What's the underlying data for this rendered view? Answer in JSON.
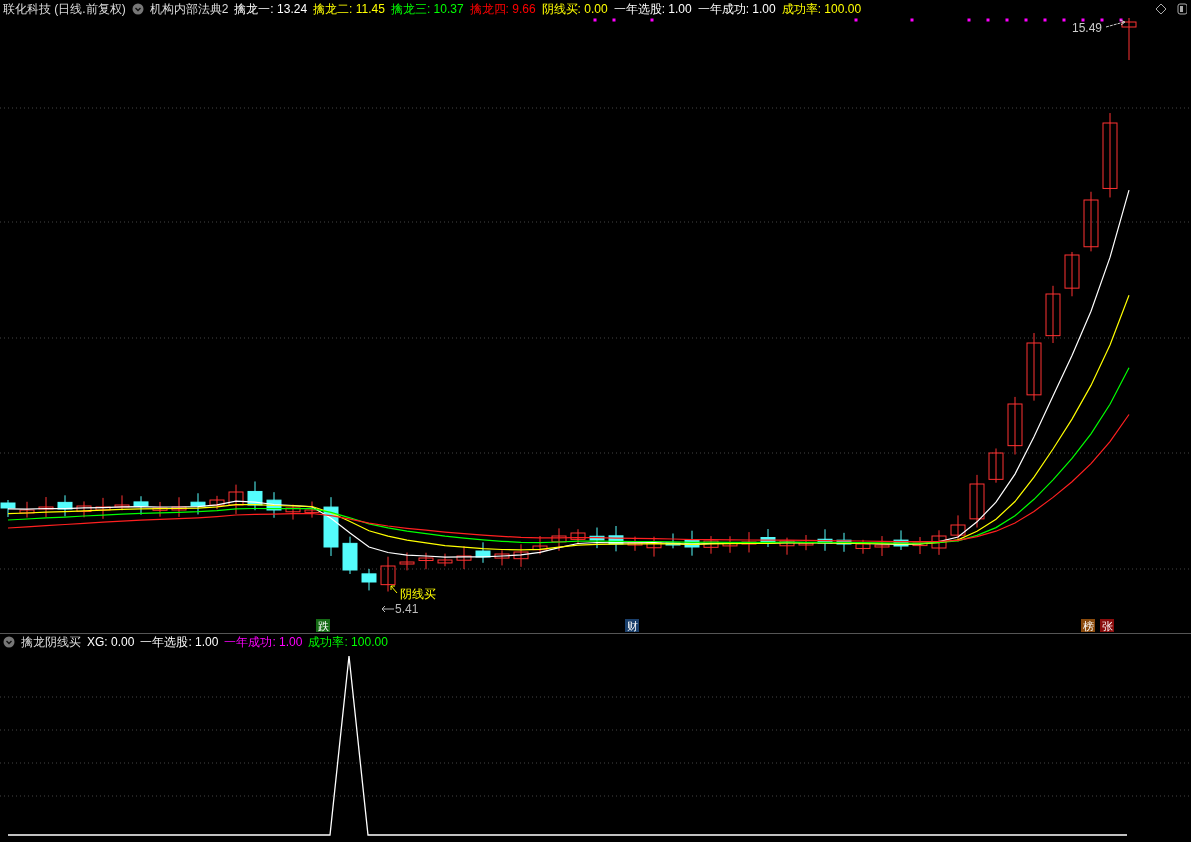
{
  "header": {
    "stock": "联化科技 (日线.前复权)",
    "indicator": "机构内部法典2",
    "values": [
      {
        "label": "擒龙一:",
        "value": "13.24",
        "color": "#ffffff"
      },
      {
        "label": "擒龙二:",
        "value": "11.45",
        "color": "#ffff00"
      },
      {
        "label": "擒龙三:",
        "value": "10.37",
        "color": "#00ff00"
      },
      {
        "label": "擒龙四:",
        "value": "9.66",
        "color": "#ff0000"
      },
      {
        "label": "阴线买:",
        "value": "0.00",
        "color": "#ffff00"
      },
      {
        "label": "一年选股:",
        "value": "1.00",
        "color": "#ffffff"
      },
      {
        "label": "一年成功:",
        "value": "1.00",
        "color": "#ffffff"
      },
      {
        "label": "成功率:",
        "value": "100.00",
        "color": "#ffff00"
      }
    ]
  },
  "main_chart": {
    "high_label": "15.49",
    "low_label": "5.41",
    "signal_label": "阴线买",
    "events": [
      {
        "text": "跌",
        "color": "#156b15"
      },
      {
        "text": "财",
        "color": "#1a3f6b"
      },
      {
        "text": "榜",
        "color": "#8a4a0c"
      },
      {
        "text": "张",
        "color": "#8a0c0c"
      }
    ]
  },
  "sub_panel": {
    "title": "擒龙阴线买",
    "values": [
      {
        "label": "XG:",
        "value": "0.00",
        "color": "#ffffff"
      },
      {
        "label": "一年选股:",
        "value": "1.00",
        "color": "#ffffff"
      },
      {
        "label": "一年成功:",
        "value": "1.00",
        "color": "#ff00ff"
      },
      {
        "label": "成功率:",
        "value": "100.00",
        "color": "#00ff00"
      }
    ]
  }
}
